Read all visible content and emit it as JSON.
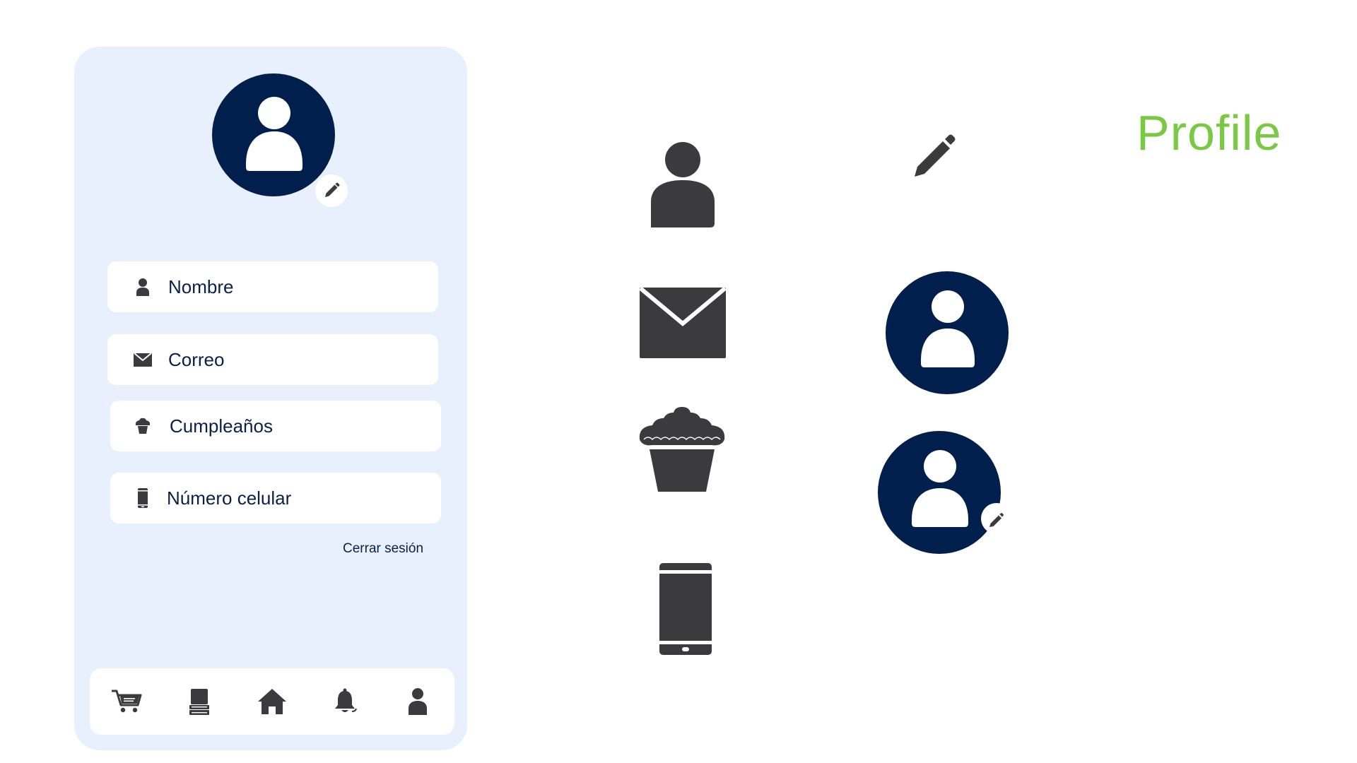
{
  "page": {
    "title": "Profile"
  },
  "colors": {
    "accent": "#7ac943",
    "navy": "#001f4d",
    "panel": "#e8f0fd",
    "icon": "#3b3b3d",
    "text": "#0c1f47"
  },
  "profile": {
    "avatar_icon": "user-avatar-icon",
    "edit_icon": "pencil-icon",
    "fields": [
      {
        "label": "Nombre",
        "icon": "user-icon"
      },
      {
        "label": "Correo",
        "icon": "envelope-icon"
      },
      {
        "label": "Cumpleaños",
        "icon": "cupcake-icon"
      },
      {
        "label": "Número celular",
        "icon": "mobile-phone-icon"
      }
    ],
    "logout_label": "Cerrar sesión"
  },
  "bottom_nav": [
    {
      "icon": "cart-icon"
    },
    {
      "icon": "books-icon"
    },
    {
      "icon": "home-icon"
    },
    {
      "icon": "bell-icon"
    },
    {
      "icon": "user-icon"
    }
  ],
  "asset_icons": [
    "user-icon",
    "pencil-icon",
    "envelope-icon",
    "user-avatar-icon",
    "cupcake-icon",
    "user-avatar-with-edit-icon",
    "mobile-phone-icon"
  ]
}
